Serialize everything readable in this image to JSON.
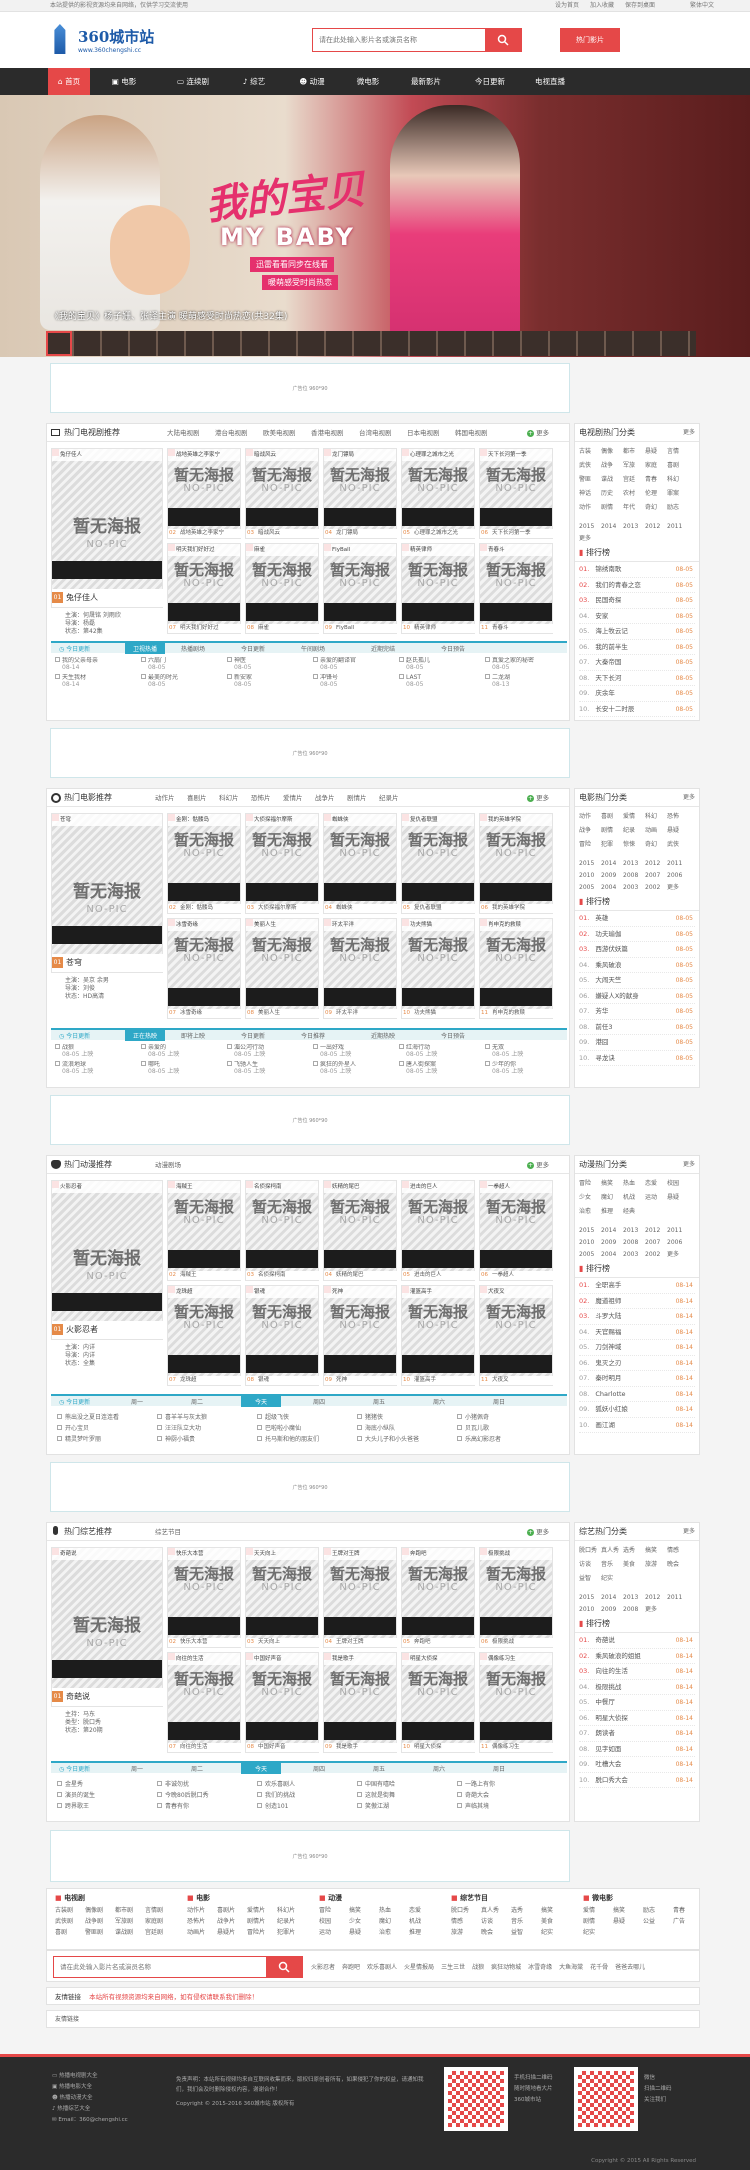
{
  "topbar": {
    "left": "本站提供的影视资源均来自网络，仅供学习交流使用",
    "right": [
      "设为首页",
      "加入收藏",
      "保存到桌面",
      "繁体中文"
    ]
  },
  "header": {
    "logo_text": "360城市站",
    "logo_url": "www.360chengshi.cc",
    "search_placeholder": "请在此处输入影片名或演员名称",
    "hot_label": "热门影片"
  },
  "nav": [
    "首页",
    "电影",
    "连续剧",
    "综艺",
    "动漫",
    "微电影",
    "最新影片",
    "今日更新",
    "电视直播"
  ],
  "banner": {
    "title_cn": "我的宝贝",
    "title_en": "MY BABY",
    "sub1": "迅雷看看同步在线看",
    "sub2": "暖萌感受时尚热恋",
    "caption": "《我的宝贝》杨子姗、张译主演 暖萌感受时尚热恋(共32集)"
  },
  "ad_text": "广告位 960*90",
  "tv": {
    "title": "热门电视剧推荐",
    "tabs": [
      "大陆电视剧",
      "港台电视剧",
      "欧美电视剧",
      "香港电视剧",
      "台湾电视剧",
      "日本电视剧",
      "韩国电视剧"
    ],
    "more": "更多",
    "feature": {
      "tag": "兔仔佳人",
      "caption": "兔仔佳人",
      "info": [
        "主演：何晟铭 刘雨欣",
        "导演：杨磊",
        "状态：第42集"
      ]
    },
    "grid": [
      {
        "tag": "战地英雄之李家宁",
        "cap": "战地英雄之李家宁"
      },
      {
        "tag": "暗战风云",
        "cap": "暗战风云"
      },
      {
        "tag": "龙门镖局",
        "cap": "龙门镖局"
      },
      {
        "tag": "心理罪之城市之光",
        "cap": "心理罪之城市之光"
      },
      {
        "tag": "天下长河第一季",
        "cap": "天下长河第一季"
      },
      {
        "tag": "明天我们好好过",
        "cap": "明天我们好好过"
      },
      {
        "tag": "麻雀",
        "cap": "麻雀"
      },
      {
        "tag": "FlyBall",
        "cap": "FlyBall"
      },
      {
        "tag": "精英律师",
        "cap": "精英律师"
      },
      {
        "tag": "青春斗",
        "cap": "青春斗"
      }
    ],
    "bar": {
      "label": "今日更新",
      "tabs": [
        "卫视热播",
        "热播剧场",
        "今日更新",
        "午间剧场",
        "近期完结",
        "今日预告"
      ]
    },
    "updates": [
      [
        "我的父亲母亲",
        "08-14"
      ],
      [
        "六扇门",
        "08-05"
      ],
      [
        "神医",
        "08-05"
      ],
      [
        "亲爱的翻译官",
        "08-05"
      ],
      [
        "赵氏孤儿",
        "08-05"
      ],
      [
        "真爱之家的秘密",
        "08-05"
      ],
      [
        "天生我材",
        "08-14"
      ],
      [
        "最美的时光",
        "08-05"
      ],
      [
        "新安家",
        "08-05"
      ],
      [
        "冲锋号",
        "08-05"
      ],
      [
        "LAST",
        "08-05"
      ],
      [
        "二龙湖",
        "08-13"
      ]
    ],
    "side_title": "电视剧热门分类",
    "side_more": "更多",
    "side_tags": [
      "古装",
      "偶像",
      "都市",
      "悬疑",
      "言情",
      "武侠",
      "战争",
      "军旅",
      "家庭",
      "喜剧",
      "警匪",
      "谍战",
      "宫廷",
      "青春",
      "科幻",
      "神话",
      "历史",
      "农村",
      "伦理",
      "罪案",
      "动作",
      "剧情",
      "年代",
      "奇幻",
      "励志"
    ],
    "years": [
      "2015",
      "2014",
      "2013",
      "2012",
      "2011"
    ],
    "rank_title": "排行榜",
    "ranks": [
      [
        "锦绣南歌",
        "08-05"
      ],
      [
        "我们的青春之恋",
        "08-05"
      ],
      [
        "民国奇探",
        "08-05"
      ],
      [
        "安家",
        "08-05"
      ],
      [
        "海上牧云记",
        "08-05"
      ],
      [
        "我的前半生",
        "08-05"
      ],
      [
        "大秦帝国",
        "08-05"
      ],
      [
        "天下长河",
        "08-05"
      ],
      [
        "庆余年",
        "08-05"
      ],
      [
        "长安十二时辰",
        "08-05"
      ]
    ]
  },
  "movie": {
    "title": "热门电影推荐",
    "tabs": [
      "动作片",
      "喜剧片",
      "科幻片",
      "恐怖片",
      "爱情片",
      "战争片",
      "剧情片",
      "纪录片"
    ],
    "more": "更多",
    "feature": {
      "tag": "苍穹",
      "caption": "苍穹",
      "info": [
        "主演：吴京 余男",
        "导演：刘俊",
        "状态：HD高清"
      ]
    },
    "grid": [
      {
        "tag": "金刚：骷髅岛",
        "cap": "金刚：骷髅岛"
      },
      {
        "tag": "大侦探福尔摩斯",
        "cap": "大侦探福尔摩斯"
      },
      {
        "tag": "蜘蛛侠",
        "cap": "蜘蛛侠"
      },
      {
        "tag": "复仇者联盟",
        "cap": "复仇者联盟"
      },
      {
        "tag": "我的英雄学院",
        "cap": "我的英雄学院"
      },
      {
        "tag": "冰雪奇缘",
        "cap": "冰雪奇缘"
      },
      {
        "tag": "美丽人生",
        "cap": "美丽人生"
      },
      {
        "tag": "环太平洋",
        "cap": "环太平洋"
      },
      {
        "tag": "功夫熊猫",
        "cap": "功夫熊猫"
      },
      {
        "tag": "肖申克的救赎",
        "cap": "肖申克的救赎"
      }
    ],
    "bar": {
      "label": "今日更新",
      "tabs": [
        "正在热映",
        "即将上映",
        "今日更新",
        "今日推荐",
        "近期热映",
        "今日预告"
      ]
    },
    "updates": [
      [
        "战狼",
        "08-05 上映"
      ],
      [
        "亲爱的",
        "08-05 上映"
      ],
      [
        "湄公河行动",
        "08-05 上映"
      ],
      [
        "一出好戏",
        "08-05 上映"
      ],
      [
        "红海行动",
        "08-05 上映"
      ],
      [
        "无双",
        "08-05 上映"
      ],
      [
        "流浪地球",
        "08-05 上映"
      ],
      [
        "哪吒",
        "08-05 上映"
      ],
      [
        "飞驰人生",
        "08-05 上映"
      ],
      [
        "疯狂的外星人",
        "08-05 上映"
      ],
      [
        "唐人街探案",
        "08-05 上映"
      ],
      [
        "少年的你",
        "08-05 上映"
      ]
    ],
    "side_title": "电影热门分类",
    "side_more": "更多",
    "side_tags": [
      "动作",
      "喜剧",
      "爱情",
      "科幻",
      "恐怖",
      "战争",
      "剧情",
      "纪录",
      "动画",
      "悬疑",
      "冒险",
      "犯罪",
      "惊悚",
      "奇幻",
      "武侠"
    ],
    "years": [
      "2015",
      "2014",
      "2013",
      "2012",
      "2011",
      "2010",
      "2009",
      "2008",
      "2007",
      "2006",
      "2005",
      "2004",
      "2003",
      "2002"
    ],
    "rank_title": "排行榜",
    "ranks": [
      [
        "英雄",
        "08-05"
      ],
      [
        "功夫瑜伽",
        "08-05"
      ],
      [
        "西游伏妖篇",
        "08-05"
      ],
      [
        "乘风破浪",
        "08-05"
      ],
      [
        "大闹天竺",
        "08-05"
      ],
      [
        "嫌疑人X的献身",
        "08-05"
      ],
      [
        "芳华",
        "08-05"
      ],
      [
        "前任3",
        "08-05"
      ],
      [
        "港囧",
        "08-05"
      ],
      [
        "寻龙诀",
        "08-05"
      ]
    ]
  },
  "anime": {
    "title": "热门动漫推荐",
    "tabs": [
      "动漫剧场"
    ],
    "more": "更多",
    "feature": {
      "tag": "火影忍者",
      "caption": "火影忍者",
      "info": [
        "主演：内详",
        "导演：内详",
        "状态：全集"
      ]
    },
    "grid": [
      {
        "tag": "海贼王",
        "cap": "海贼王"
      },
      {
        "tag": "名侦探柯南",
        "cap": "名侦探柯南"
      },
      {
        "tag": "妖精的尾巴",
        "cap": "妖精的尾巴"
      },
      {
        "tag": "进击的巨人",
        "cap": "进击的巨人"
      },
      {
        "tag": "一拳超人",
        "cap": "一拳超人"
      },
      {
        "tag": "龙珠超",
        "cap": "龙珠超"
      },
      {
        "tag": "银魂",
        "cap": "银魂"
      },
      {
        "tag": "死神",
        "cap": "死神"
      },
      {
        "tag": "灌篮高手",
        "cap": "灌篮高手"
      },
      {
        "tag": "犬夜叉",
        "cap": "犬夜叉"
      }
    ],
    "bar": {
      "label": "今日更新",
      "tabs": [
        "周一",
        "周二",
        "今天",
        "周四",
        "周五",
        "周六",
        "周日"
      ]
    },
    "updates": [
      "熊出没之夏日连连看",
      "喜羊羊与灰太狼",
      "超级飞侠",
      "猪猪侠",
      "小猪佩奇",
      "开心宝贝",
      "汪汪队立大功",
      "巴啦啦小魔仙",
      "海底小纵队",
      "贝瓦儿歌",
      "精灵梦叶罗丽",
      "神厨小福贵",
      "托马斯和他的朋友们",
      "大头儿子和小头爸爸",
      "乐高幻影忍者"
    ],
    "side_title": "动漫热门分类",
    "side_more": "更多",
    "side_tags": [
      "冒险",
      "搞笑",
      "热血",
      "恋爱",
      "校园",
      "少女",
      "魔幻",
      "机战",
      "运动",
      "悬疑",
      "治愈",
      "推理",
      "经典"
    ],
    "years": [
      "2015",
      "2014",
      "2013",
      "2012",
      "2011",
      "2010",
      "2009",
      "2008",
      "2007",
      "2006",
      "2005",
      "2004",
      "2003",
      "2002"
    ],
    "rank_title": "排行榜",
    "ranks": [
      [
        "全职高手",
        "08-14"
      ],
      [
        "魔道祖师",
        "08-14"
      ],
      [
        "斗罗大陆",
        "08-14"
      ],
      [
        "天官赐福",
        "08-14"
      ],
      [
        "刀剑神域",
        "08-14"
      ],
      [
        "鬼灭之刃",
        "08-14"
      ],
      [
        "秦时明月",
        "08-14"
      ],
      [
        "Charlotte",
        "08-14"
      ],
      [
        "狐妖小红娘",
        "08-14"
      ],
      [
        "画江湖",
        "08-14"
      ]
    ]
  },
  "variety": {
    "title": "热门综艺推荐",
    "tabs": [
      "综艺节目"
    ],
    "more": "更多",
    "feature": {
      "tag": "奇葩说",
      "caption": "奇葩说",
      "info": [
        "主持：马东",
        "类型：脱口秀",
        "状态：第20期"
      ]
    },
    "grid": [
      {
        "tag": "快乐大本营",
        "cap": "快乐大本营"
      },
      {
        "tag": "天天向上",
        "cap": "天天向上"
      },
      {
        "tag": "王牌对王牌",
        "cap": "王牌对王牌"
      },
      {
        "tag": "奔跑吧",
        "cap": "奔跑吧"
      },
      {
        "tag": "极限挑战",
        "cap": "极限挑战"
      },
      {
        "tag": "向往的生活",
        "cap": "向往的生活"
      },
      {
        "tag": "中国好声音",
        "cap": "中国好声音"
      },
      {
        "tag": "我是歌手",
        "cap": "我是歌手"
      },
      {
        "tag": "明星大侦探",
        "cap": "明星大侦探"
      },
      {
        "tag": "偶像练习生",
        "cap": "偶像练习生"
      }
    ],
    "bar": {
      "label": "今日更新",
      "tabs": [
        "周一",
        "周二",
        "今天",
        "周四",
        "周五",
        "周六",
        "周日"
      ]
    },
    "updates": [
      "金星秀",
      "非诚勿扰",
      "欢乐喜剧人",
      "中国有嘻哈",
      "一路上有你",
      "演员的诞生",
      "今晚80后脱口秀",
      "我们的挑战",
      "这就是街舞",
      "奇葩大会",
      "跨界歌王",
      "青春有你",
      "创造101",
      "笑傲江湖",
      "声临其境"
    ],
    "side_title": "综艺热门分类",
    "side_more": "更多",
    "side_tags": [
      "脱口秀",
      "真人秀",
      "选秀",
      "搞笑",
      "情感",
      "访谈",
      "音乐",
      "美食",
      "旅游",
      "晚会",
      "益智",
      "纪实"
    ],
    "years": [
      "2015",
      "2014",
      "2013",
      "2012",
      "2011",
      "2010",
      "2009",
      "2008"
    ],
    "rank_title": "排行榜",
    "ranks": [
      [
        "奇葩说",
        "08-14"
      ],
      [
        "乘风破浪的姐姐",
        "08-14"
      ],
      [
        "向往的生活",
        "08-14"
      ],
      [
        "极限挑战",
        "08-14"
      ],
      [
        "中餐厅",
        "08-14"
      ],
      [
        "明星大侦探",
        "08-14"
      ],
      [
        "朗读者",
        "08-14"
      ],
      [
        "见字如面",
        "08-14"
      ],
      [
        "吐槽大会",
        "08-14"
      ],
      [
        "脱口秀大会",
        "08-14"
      ]
    ]
  },
  "footer_links": [
    {
      "title": "电视剧",
      "items": [
        "古装剧",
        "偶像剧",
        "都市剧",
        "言情剧",
        "武侠剧",
        "战争剧",
        "军旅剧",
        "家庭剧",
        "喜剧",
        "警匪剧",
        "谍战剧",
        "宫廷剧"
      ]
    },
    {
      "title": "电影",
      "items": [
        "动作片",
        "喜剧片",
        "爱情片",
        "科幻片",
        "恐怖片",
        "战争片",
        "剧情片",
        "纪录片",
        "动画片",
        "悬疑片",
        "冒险片",
        "犯罪片"
      ]
    },
    {
      "title": "动漫",
      "items": [
        "冒险",
        "搞笑",
        "热血",
        "恋爱",
        "校园",
        "少女",
        "魔幻",
        "机战",
        "运动",
        "悬疑",
        "治愈",
        "推理"
      ]
    },
    {
      "title": "综艺节目",
      "items": [
        "脱口秀",
        "真人秀",
        "选秀",
        "搞笑",
        "情感",
        "访谈",
        "音乐",
        "美食",
        "旅游",
        "晚会",
        "益智",
        "纪实"
      ]
    },
    {
      "title": "微电影",
      "items": [
        "爱情",
        "搞笑",
        "励志",
        "青春",
        "剧情",
        "悬疑",
        "公益",
        "广告",
        "纪实"
      ]
    }
  ],
  "bottom_search": {
    "placeholder": "请在此处输入影片名或演员名称",
    "hot": [
      "火影忍者",
      "奔跑吧",
      "欢乐喜剧人",
      "火星情报局",
      "三生三世",
      "战狼",
      "疯狂动物城",
      "冰雪奇缘",
      "大鱼海棠",
      "花千骨",
      "爸爸去哪儿"
    ]
  },
  "notice": {
    "label": "友情链接",
    "text": "本站所有视频资源均来自网络，如有侵权请联系我们删除！"
  },
  "friend_link": "友情链接",
  "footer": {
    "left": [
      "热播电视剧大全",
      "热播电影大全",
      "热播动漫大全",
      "热播综艺大全",
      "Email：360@chengshi.cc"
    ],
    "mid": [
      "免责声明：本站所有视频均来自互联网收集而来，版权归原创者所有，如果侵犯了你的权益，请通知我们，我们会及时删除侵权内容，谢谢合作！",
      "Copyright © 2015-2016 360城市站 版权所有"
    ],
    "qr1": [
      "手机扫描二维码",
      "随时随地看大片",
      "360城市站"
    ],
    "qr2": [
      "微信",
      "扫描二维码",
      "关注我们"
    ],
    "copyright": "Copyright © 2015 All Rights Reserved"
  }
}
